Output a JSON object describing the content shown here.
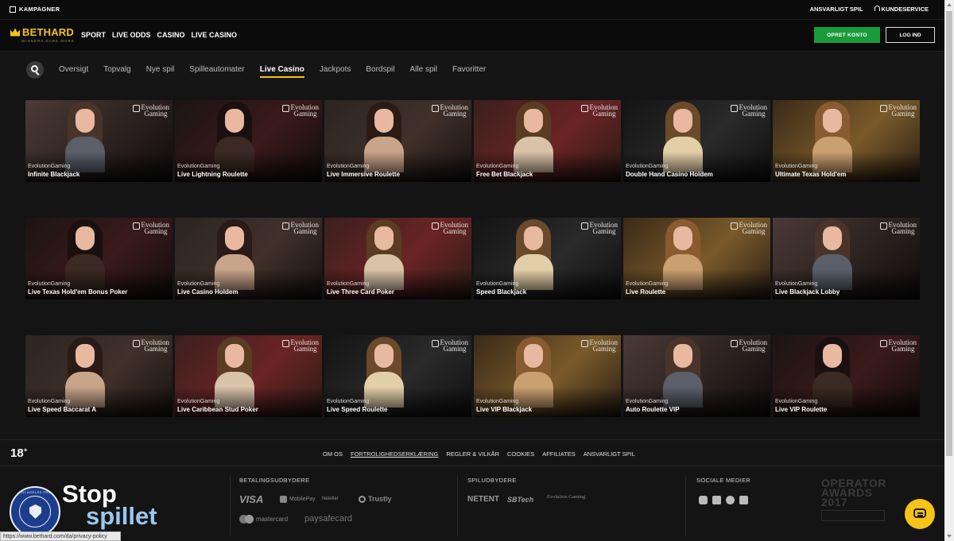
{
  "topbar": {
    "promotions": "KAMPAGNER",
    "responsible": "ANSVARLIGT SPIL",
    "support": "KUNDESERVICE"
  },
  "header": {
    "logo_name": "BETHARD",
    "logo_tagline": "WINNERS DARE MORE",
    "nav": [
      "SPORT",
      "LIVE ODDS",
      "CASINO",
      "LIVE CASINO"
    ],
    "create_account": "OPRET KONTO",
    "login": "LOG IND"
  },
  "categories": {
    "items": [
      "Oversigt",
      "Topvalg",
      "Nye spil",
      "Spilleautomater",
      "Live Casino",
      "Jackpots",
      "Bordspil",
      "Alle spil",
      "Favoritter"
    ],
    "active": "Live Casino"
  },
  "games": [
    {
      "provider": "EvolutionGaming",
      "title": "Infinite Blackjack"
    },
    {
      "provider": "EvolutionGaming",
      "title": "Live Lightning Roulette"
    },
    {
      "provider": "EvolutionGaming",
      "title": "Live Immersive Roulette"
    },
    {
      "provider": "EvolutionGaming",
      "title": "Free Bet Blackjack"
    },
    {
      "provider": "EvolutionGaming",
      "title": "Double Hand Casino Holdem"
    },
    {
      "provider": "EvolutionGaming",
      "title": "Ultimate Texas Hold'em"
    },
    {
      "provider": "EvolutionGaming",
      "title": "Live Texas Hold'em Bonus Poker"
    },
    {
      "provider": "EvolutionGaming",
      "title": "Live Casino Holdem"
    },
    {
      "provider": "EvolutionGaming",
      "title": "Live Three Card Poker"
    },
    {
      "provider": "EvolutionGaming",
      "title": "Speed Blackjack"
    },
    {
      "provider": "EvolutionGaming",
      "title": "Live Roulette"
    },
    {
      "provider": "EvolutionGaming",
      "title": "Live Blackjack Lobby"
    },
    {
      "provider": "EvolutionGaming",
      "title": "Live Speed Baccarat A"
    },
    {
      "provider": "EvolutionGaming",
      "title": "Live Caribbean Stud Poker"
    },
    {
      "provider": "EvolutionGaming",
      "title": "Live Speed Roulette"
    },
    {
      "provider": "EvolutionGaming",
      "title": "Live VIP Blackjack"
    },
    {
      "provider": "EvolutionGaming",
      "title": "Auto Roulette VIP"
    },
    {
      "provider": "EvolutionGaming",
      "title": "Live VIP Roulette"
    }
  ],
  "tile_logo": {
    "line1": "Evolution",
    "line2": "Gaming"
  },
  "footer": {
    "age": "18",
    "age_plus": "+",
    "links": [
      "OM OS",
      "FORTROLIGHEDSERKLÆRING",
      "REGLER & VILKÅR",
      "COOKIES",
      "AFFILIATES",
      "ANSVARLIGT SPIL"
    ],
    "payments_heading": "BETALINGSUDBYDERE",
    "payments": [
      "VISA",
      "MobilePay",
      "Neteller",
      "Trustly",
      "mastercard",
      "paysafecard"
    ],
    "providers_heading": "SPILUDBYDERE",
    "providers": [
      "NETENT",
      "SBTech",
      "Evolution Gaming"
    ],
    "social_heading": "SOCIALE MEDIER",
    "social": [
      "instagram-icon",
      "facebook-icon",
      "twitter-icon",
      "youtube-icon"
    ],
    "award": {
      "line1": "OPERATOR",
      "line2": "AWARDS 2017"
    },
    "seal_text": "TILLADELSE FRA",
    "stop_line1": "Stop",
    "stop_line2": "spillet"
  },
  "statusbar": "https://www.bethard.com/da/privacy-policy",
  "colors": {
    "accent": "#f7c21a",
    "create": "#1a9b3a",
    "background": "#141414"
  }
}
